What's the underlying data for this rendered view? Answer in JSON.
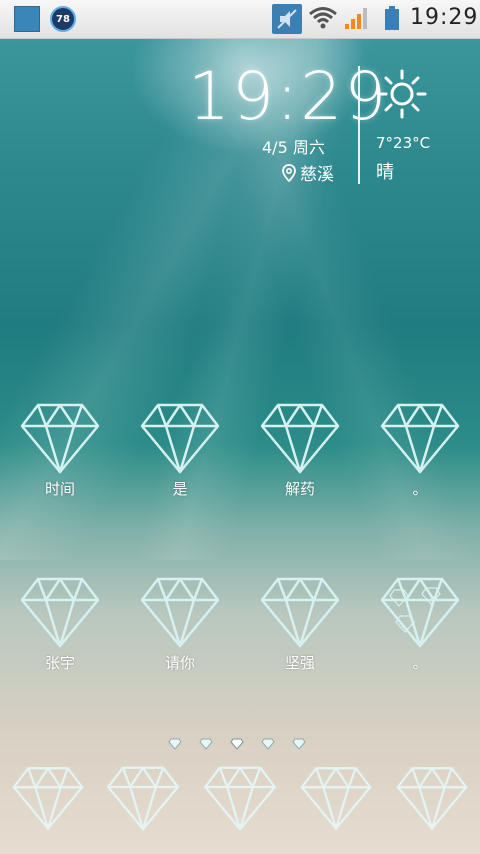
{
  "statusbar": {
    "badge_count": "78",
    "time": "19:29",
    "icons": [
      "app-icon",
      "count-badge-icon",
      "mute-icon",
      "wifi-icon",
      "signal-icon",
      "battery-icon"
    ]
  },
  "widget": {
    "time": "19:29",
    "date": "4/5 周六",
    "location": "慈溪",
    "temperature": "7°23°C",
    "condition": "晴",
    "weather_icon": "sun-icon"
  },
  "apps_row1": [
    {
      "label": "时间"
    },
    {
      "label": "是"
    },
    {
      "label": "解药"
    },
    {
      "label": "。"
    }
  ],
  "apps_row2": [
    {
      "label": "张宇"
    },
    {
      "label": "请你"
    },
    {
      "label": "坚强"
    },
    {
      "label": "。"
    }
  ],
  "page_indicator": {
    "pages": 5,
    "current": 3
  },
  "dock": {
    "items": 5
  },
  "colors": {
    "icon_stroke": "#d6f1f1",
    "statusbar_bg": "#ececec",
    "accent_blue": "#3e7fb2"
  }
}
